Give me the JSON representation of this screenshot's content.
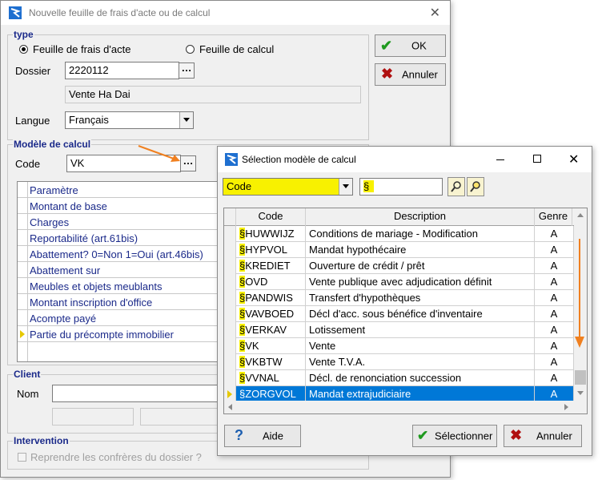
{
  "main_window": {
    "title": "Nouvelle feuille de frais d'acte ou de calcul",
    "type_group": {
      "title": "type",
      "radio_frais": "Feuille de frais d'acte",
      "radio_calcul": "Feuille de calcul",
      "selected": "frais"
    },
    "dossier_label": "Dossier",
    "dossier_value": "2220112",
    "dossier_name": "Vente Ha Dai",
    "langue_label": "Langue",
    "langue_value": "Français",
    "modele_group": {
      "title": "Modèle de calcul",
      "code_label": "Code",
      "code_value": "VK",
      "params": [
        "Paramètre",
        "Montant de base",
        "Charges",
        "Reportabilité (art.61bis)",
        "Abattement? 0=Non 1=Oui (art.46bis)",
        "Abattement sur",
        "Meubles et objets meublants",
        "Montant inscription d'office",
        "Acompte payé",
        "Partie du précompte immobilier"
      ]
    },
    "client_group": {
      "title": "Client",
      "nom_label": "Nom"
    },
    "intervention_group": {
      "title": "Intervention",
      "checkbox_label": "Reprendre les confrères du dossier ?"
    },
    "ok_label": "OK",
    "annuler_label": "Annuler"
  },
  "dialog": {
    "title": "Sélection modèle de calcul",
    "filter_field": "Code",
    "filter_value": "§",
    "columns": {
      "code": "Code",
      "description": "Description",
      "genre": "Genre"
    },
    "rows": [
      {
        "code": "HUWWIJZ",
        "description": "Conditions de mariage - Modification",
        "genre": "A"
      },
      {
        "code": "HYPVOL",
        "description": "Mandat hypothécaire",
        "genre": "A"
      },
      {
        "code": "KREDIET",
        "description": "Ouverture de crédit / prêt",
        "genre": "A"
      },
      {
        "code": "OVD",
        "description": "Vente publique avec adjudication définit",
        "genre": "A"
      },
      {
        "code": "PANDWIS",
        "description": "Transfert d'hypothèques",
        "genre": "A"
      },
      {
        "code": "VAVBOED",
        "description": "Décl d'acc. sous bénéfice d'inventaire",
        "genre": "A"
      },
      {
        "code": "VERKAV",
        "description": "Lotissement",
        "genre": "A"
      },
      {
        "code": "VK",
        "description": "Vente",
        "genre": "A"
      },
      {
        "code": "VKBTW",
        "description": "Vente T.V.A.",
        "genre": "A"
      },
      {
        "code": "VVNAL",
        "description": "Décl. de renonciation succession",
        "genre": "A"
      },
      {
        "code": "ZORGVOL",
        "description": "Mandat extrajudiciaire",
        "genre": "A"
      }
    ],
    "code_prefix": "§",
    "selected_row": 10,
    "aide_label": "Aide",
    "selectionner_label": "Sélectionner",
    "annuler_label": "Annuler"
  },
  "colors": {
    "accent_title": "#1b2a8a",
    "selection": "#0078d7",
    "highlight": "#f8f100",
    "arrow": "#f08020"
  }
}
